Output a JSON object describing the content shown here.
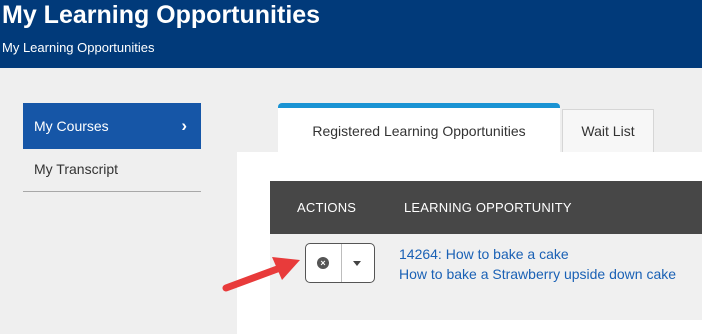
{
  "header": {
    "title": "My Learning Opportunities",
    "subtitle": "My Learning Opportunities"
  },
  "sidebar": {
    "items": [
      {
        "label": "My Courses",
        "active": true
      },
      {
        "label": "My Transcript",
        "active": false
      }
    ]
  },
  "tabs": [
    {
      "label": "Registered Learning Opportunities",
      "active": true
    },
    {
      "label": "Wait List",
      "active": false
    }
  ],
  "table": {
    "columns": [
      "ACTIONS",
      "LEARNING OPPORTUNITY"
    ],
    "rows": [
      {
        "code_title": "14264: How to bake a cake",
        "description": "How to bake a Strawberry upside down cake"
      }
    ]
  },
  "icons": {
    "remove": "circle-x-icon",
    "dropdown": "caret-down-icon",
    "sidebar_active": "chevron-right-icon",
    "annotation": "red-arrow-icon"
  },
  "colors": {
    "header_bg": "#013a7a",
    "sidebar_active_bg": "#1656a7",
    "tab_accent": "#1a93d3",
    "table_header_bg": "#474747",
    "link": "#1a61b5",
    "annotation_arrow": "#e83b3b"
  }
}
